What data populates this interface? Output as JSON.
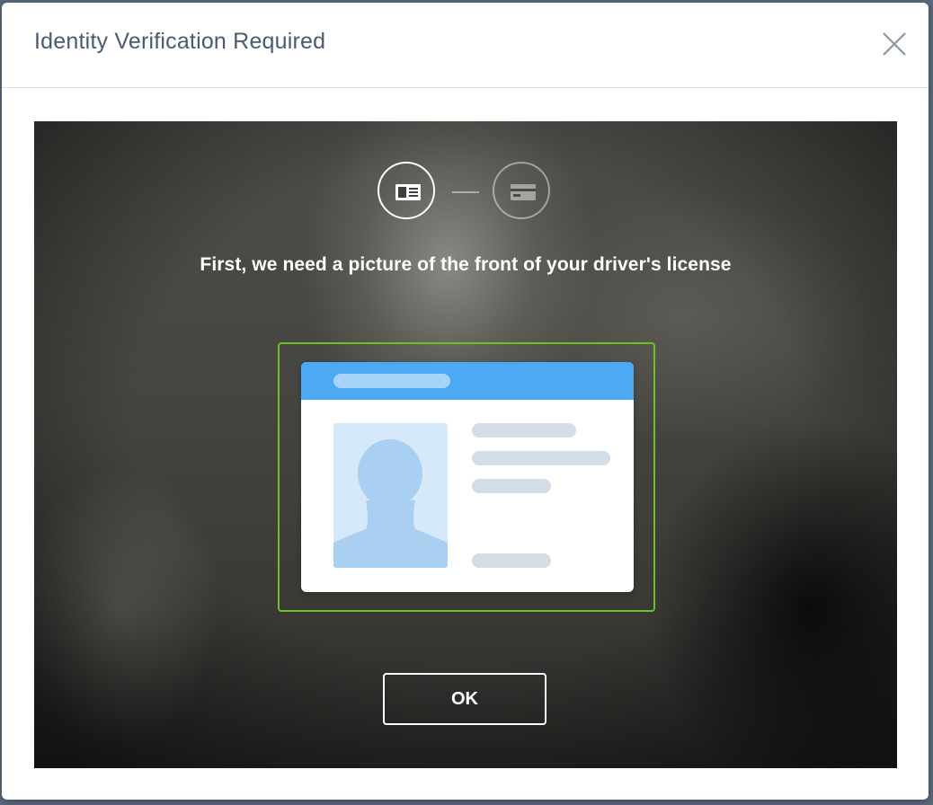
{
  "dialog": {
    "title": "Identity Verification Required",
    "close_icon": "close-icon"
  },
  "camera_view": {
    "steps": [
      {
        "icon": "license-front-icon",
        "state": "active"
      },
      {
        "icon": "license-back-icon",
        "state": "inactive"
      }
    ],
    "instruction": "First, we need a picture of the front of your driver's license",
    "frame_color": "#6cc31e",
    "card_illustration": {
      "header_color": "#4caaf5",
      "photo_icon": "person-silhouette-icon"
    },
    "ok_button_label": "OK"
  }
}
